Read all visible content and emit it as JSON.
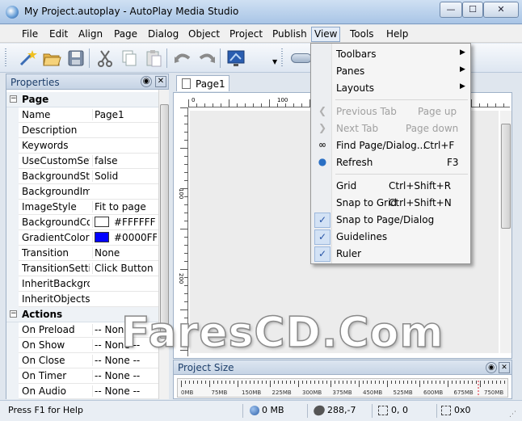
{
  "window": {
    "title": "My Project.autoplay - AutoPlay Media Studio",
    "min": "—",
    "max": "☐",
    "close": "✕"
  },
  "menubar": [
    "File",
    "Edit",
    "Align",
    "Page",
    "Dialog",
    "Object",
    "Project",
    "Publish",
    "View",
    "Tools",
    "Help"
  ],
  "properties": {
    "title": "Properties",
    "rows": [
      {
        "type": "cat",
        "name": "Page"
      },
      {
        "type": "prop",
        "name": "Name",
        "value": "Page1"
      },
      {
        "type": "prop",
        "name": "Description",
        "value": ""
      },
      {
        "type": "prop",
        "name": "Keywords",
        "value": ""
      },
      {
        "type": "prop",
        "name": "UseCustomSett",
        "value": "false"
      },
      {
        "type": "prop",
        "name": "BackgroundStyl",
        "value": "Solid"
      },
      {
        "type": "prop",
        "name": "BackgroundIma",
        "value": ""
      },
      {
        "type": "prop",
        "name": "ImageStyle",
        "value": "Fit to page"
      },
      {
        "type": "prop",
        "name": "BackgroundCol",
        "value": "#FFFFFF",
        "swatch": "#FFFFFF"
      },
      {
        "type": "prop",
        "name": "GradientColor",
        "value": "#0000FF",
        "swatch": "#0000FF"
      },
      {
        "type": "prop",
        "name": "Transition",
        "value": "None"
      },
      {
        "type": "prop",
        "name": "TransitionSettin",
        "value": "Click Button"
      },
      {
        "type": "prop",
        "name": "InheritBackgrou",
        "value": ""
      },
      {
        "type": "prop",
        "name": "InheritObjects",
        "value": ""
      },
      {
        "type": "cat",
        "name": "Actions"
      },
      {
        "type": "prop",
        "name": "On Preload",
        "value": "-- None --"
      },
      {
        "type": "prop",
        "name": "On Show",
        "value": "-- None --"
      },
      {
        "type": "prop",
        "name": "On Close",
        "value": "-- None --"
      },
      {
        "type": "prop",
        "name": "On Timer",
        "value": "-- None --"
      },
      {
        "type": "prop",
        "name": "On Audio",
        "value": "-- None --"
      }
    ]
  },
  "tab": {
    "label": "Page1"
  },
  "ruler": {
    "top_ticks": [
      "0",
      "100"
    ],
    "left_ticks": [
      "100",
      "200"
    ]
  },
  "project_size": {
    "title": "Project Size",
    "labels": [
      "0MB",
      "75MB",
      "150MB",
      "225MB",
      "300MB",
      "375MB",
      "450MB",
      "525MB",
      "600MB",
      "675MB",
      "750MB"
    ]
  },
  "watermark": "FaresCD.Com",
  "status": {
    "help": "Press F1 for Help",
    "size": "0 MB",
    "cursor": "288,-7",
    "pos": "0, 0",
    "dim": "0x0"
  },
  "view_menu": [
    {
      "label": "Toolbars",
      "shortcut": "",
      "submenu": true
    },
    {
      "label": "Panes",
      "shortcut": "",
      "submenu": true
    },
    {
      "label": "Layouts",
      "shortcut": "",
      "submenu": true
    },
    {
      "sep": true
    },
    {
      "label": "Previous Tab",
      "shortcut": "Page up",
      "disabled": true,
      "icon": "back-arrow-icon"
    },
    {
      "label": "Next Tab",
      "shortcut": "Page down",
      "disabled": true,
      "icon": "forward-arrow-icon"
    },
    {
      "label": "Find Page/Dialog...",
      "shortcut": "Ctrl+F",
      "icon": "binoculars-icon"
    },
    {
      "label": "Refresh",
      "shortcut": "F3",
      "icon": "refresh-globe-icon"
    },
    {
      "sep": true
    },
    {
      "label": "Grid",
      "shortcut": "Ctrl+Shift+R"
    },
    {
      "label": "Snap to Grid",
      "shortcut": "Ctrl+Shift+N"
    },
    {
      "label": "Snap to Page/Dialog",
      "shortcut": "",
      "checked": true
    },
    {
      "label": "Guidelines",
      "shortcut": "",
      "checked": true
    },
    {
      "label": "Ruler",
      "shortcut": "",
      "checked": true
    }
  ]
}
